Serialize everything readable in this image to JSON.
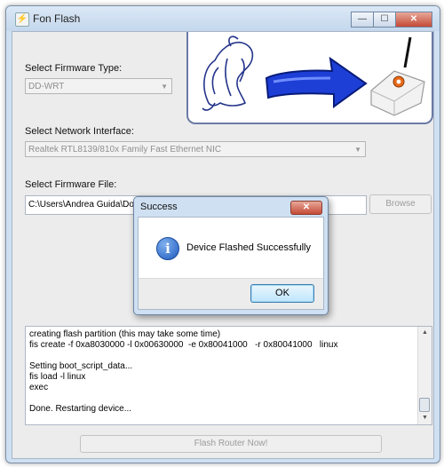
{
  "window": {
    "title": "Fon Flash",
    "icon": "app-icon",
    "minimize": "minimize-icon",
    "maximize": "maximize-icon",
    "close": "close-icon"
  },
  "firmware_type": {
    "label": "Select Firmware Type:",
    "value": "DD-WRT"
  },
  "network": {
    "label": "Select Network Interface:",
    "value": "Realtek RTL8139/810x Family Fast Ethernet NIC"
  },
  "file": {
    "label": "Select Firmware File:",
    "value": "C:\\Users\\Andrea Guida\\Dow",
    "browse_label": "Browse"
  },
  "log": {
    "lines": [
      "creating flash partition (this may take some time)",
      "fis create -f 0xa8030000 -l 0x00630000  -e 0x80041000   -r 0x80041000   linux",
      "",
      "Setting boot_script_data...",
      "fis load -l linux",
      "exec",
      "",
      "Done. Restarting device..."
    ]
  },
  "flash_button": "Flash Router Now!",
  "dialog": {
    "title": "Success",
    "message": "Device Flashed Successfully",
    "ok_label": "OK",
    "icon": "info-icon"
  },
  "colors": {
    "arrow_blue": "#1d3fd6",
    "window_frame": "#cfe0f2",
    "dialog_ok": "#bee6fd"
  }
}
